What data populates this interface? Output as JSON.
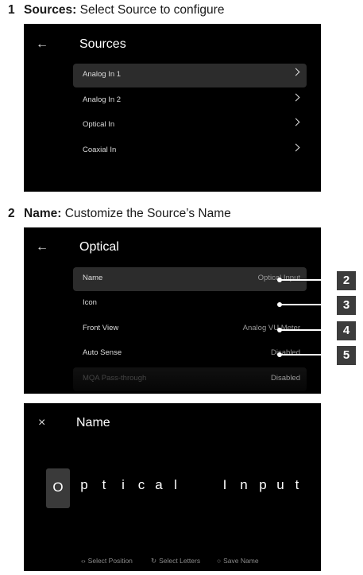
{
  "step1": {
    "num": "1",
    "title": "Sources:",
    "text": " Select Source to configure"
  },
  "step2": {
    "num": "2",
    "title": "Name:",
    "text": " Customize the Source’s Name"
  },
  "sources_panel": {
    "back_icon": "←",
    "title": "Sources",
    "items": [
      {
        "label": "Analog In 1"
      },
      {
        "label": "Analog In 2"
      },
      {
        "label": "Optical In"
      },
      {
        "label": "Coaxial In"
      }
    ]
  },
  "optical_panel": {
    "back_icon": "←",
    "title": "Optical",
    "items": [
      {
        "label": "Name",
        "value": "Optical Input"
      },
      {
        "label": "Icon",
        "value": ""
      },
      {
        "label": "Front View",
        "value": "Analog VU Meter"
      },
      {
        "label": "Auto Sense",
        "value": "Disabled"
      },
      {
        "label": "MQA Pass-through",
        "value": "Disabled"
      }
    ],
    "badges": [
      "2",
      "3",
      "4",
      "5"
    ]
  },
  "name_panel": {
    "close_icon": "×",
    "title": "Name",
    "letters": [
      "O",
      "p",
      "t",
      "i",
      "c",
      "a",
      "l",
      "I",
      "n",
      "p",
      "u",
      "t"
    ],
    "hints": {
      "position_icon": "‹›",
      "position": "Select Position",
      "letters_icon": "↻",
      "letters": "Select Letters",
      "save_icon": "○",
      "save": "Save Name"
    }
  },
  "colors": {
    "panel_bg": "#000000",
    "selected_row": "#2c2c2c",
    "badge_bg": "#3c3c3c"
  }
}
